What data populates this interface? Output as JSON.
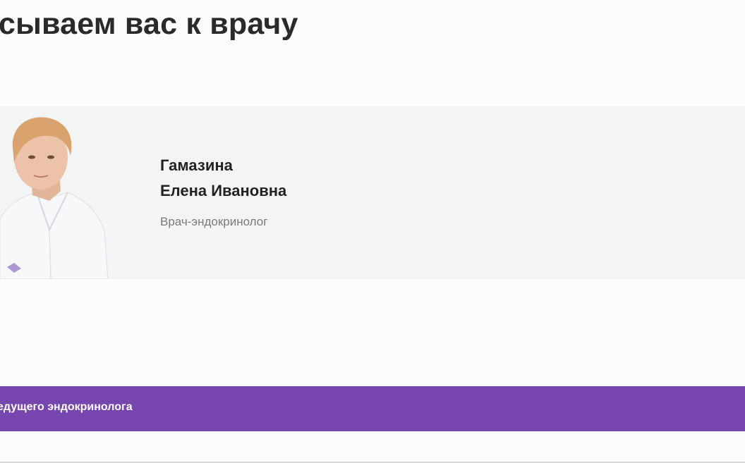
{
  "header": {
    "title": "сываем вас к врачу"
  },
  "doctor": {
    "last_name": "Гамазина",
    "first_middle_name": "Елена Ивановна",
    "specialty": "Врач-эндокринолог",
    "photo_icon": "doctor-portrait"
  },
  "cta": {
    "label": "едущего эндокринолога",
    "color": "#7645ae"
  },
  "colors": {
    "card_background": "#f3f4f4",
    "title_text": "#2a2a2a",
    "specialty_text": "#7a7a7a"
  }
}
